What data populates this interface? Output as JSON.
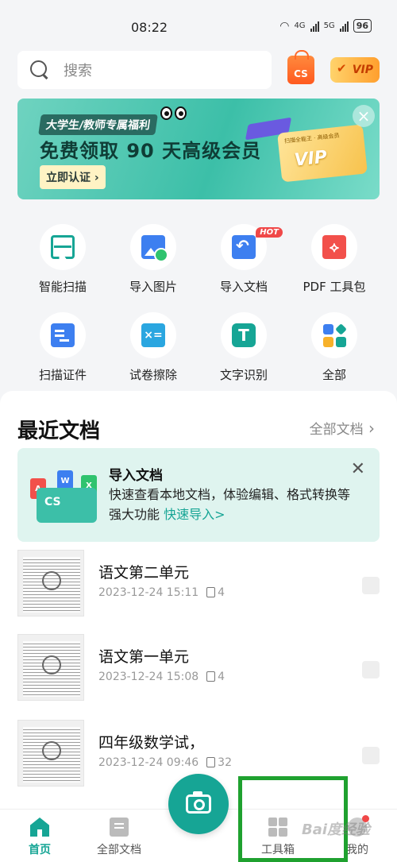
{
  "status_bar": {
    "time": "08:22",
    "battery": "96",
    "net1": "4G",
    "net2": "5G"
  },
  "search": {
    "placeholder": "搜索"
  },
  "header": {
    "shop_label": "CS",
    "vip_label": "VIP"
  },
  "banner": {
    "tag": "大学生/教师专属福利",
    "title": "免费领取 90 天高级会员",
    "button": "立即认证 ›",
    "card_text": "扫描全能王 · 高级会员",
    "card_vip": "VIP",
    "close": "×"
  },
  "tools": [
    {
      "label": "智能扫描",
      "icon": "scan-icon"
    },
    {
      "label": "导入图片",
      "icon": "import-image-icon"
    },
    {
      "label": "导入文档",
      "icon": "import-doc-icon",
      "badge": "HOT"
    },
    {
      "label": "PDF 工具包",
      "icon": "pdf-icon",
      "glyph": "⟡"
    },
    {
      "label": "扫描证件",
      "icon": "id-card-icon"
    },
    {
      "label": "试卷擦除",
      "icon": "paper-erase-icon",
      "glyph": "×="
    },
    {
      "label": "文字识别",
      "icon": "ocr-icon",
      "glyph": "T"
    },
    {
      "label": "全部",
      "icon": "all-tools-icon"
    }
  ],
  "recent": {
    "title": "最近文档",
    "all_link": "全部文档",
    "import_card": {
      "title": "导入文档",
      "desc": "快速查看本地文档，体验编辑、格式转换等强大功能",
      "link": "快速导入>",
      "folder_label": "CS",
      "doc_labels": [
        "A",
        "W",
        "X"
      ],
      "close": "✕"
    },
    "documents": [
      {
        "name": "语文第二单元",
        "time": "2023-12-24 15:11",
        "pages": "4"
      },
      {
        "name": "语文第一单元",
        "time": "2023-12-24 15:08",
        "pages": "4"
      },
      {
        "name": "四年级数学试，",
        "time": "2023-12-24 09:46",
        "pages": "32"
      }
    ]
  },
  "nav": {
    "home": "首页",
    "docs": "全部文档",
    "tools": "工具箱",
    "me": "我的"
  },
  "watermark": "Bai度经验",
  "colors": {
    "accent": "#16a595",
    "highlight": "#1fa12f"
  }
}
